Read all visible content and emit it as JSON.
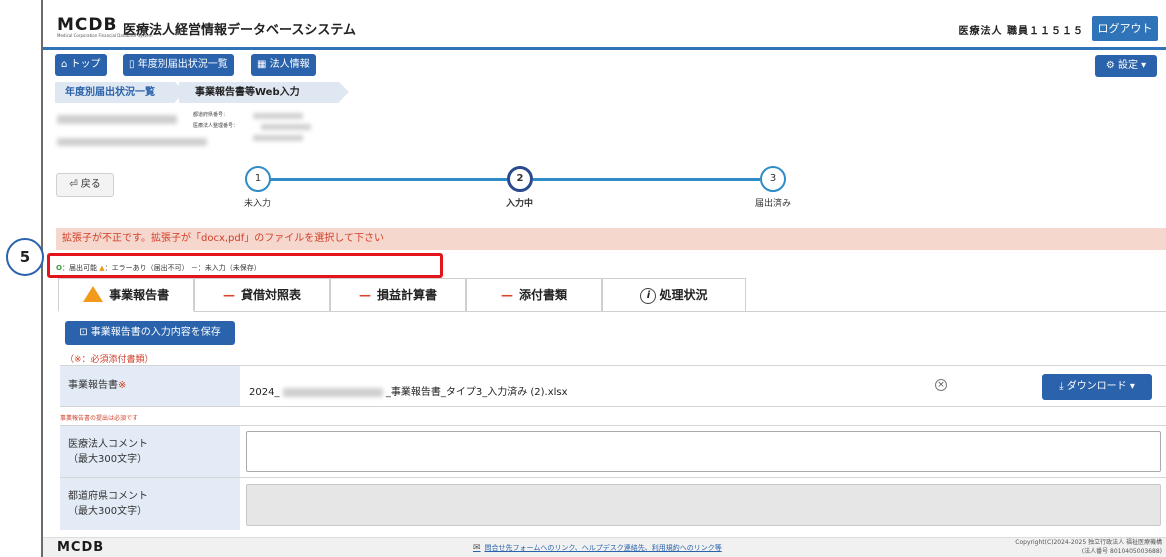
{
  "header": {
    "logo": "MCDB",
    "logo_sub": "Medical Corporation Financial Database System",
    "system_title": "医療法人経営情報データベースシステム",
    "user": "医療法人 職員１１５１５",
    "logout_label": "ログアウト"
  },
  "nav": {
    "top_label": "トップ",
    "yearly_label": "年度別届出状況一覧",
    "corp_label": "法人情報",
    "settings_label": "設定"
  },
  "breadcrumb": {
    "item1": "年度別届出状況一覧",
    "item2": "事業報告書等Web入力"
  },
  "corp_info": {
    "pref_label": "都道府県番号：",
    "corp_label": "医療法人整理番号："
  },
  "back_label": "戻る",
  "steps": [
    {
      "num": "1",
      "label": "未入力"
    },
    {
      "num": "2",
      "label": "入力中"
    },
    {
      "num": "3",
      "label": "届出済み"
    }
  ],
  "error_message": "拡張子が不正です。拡張子が「docx,pdf」のファイルを選択して下さい",
  "legend": {
    "ok_mark": "O",
    "ok_text": "：届出可能",
    "warn_mark": "▲",
    "warn_text": "：エラーあり（届出不可）",
    "dash_text": "－：未入力（未保存）"
  },
  "tabs": [
    {
      "label": "事業報告書"
    },
    {
      "label": "貸借対照表"
    },
    {
      "label": "損益計算書"
    },
    {
      "label": "添付書類"
    },
    {
      "label": "処理状況"
    }
  ],
  "save_label": "事業報告書の入力内容を保存",
  "required_note": "（※：必須添付書類）",
  "form": {
    "report_label": "事業報告書",
    "required_mark": "※",
    "file_prefix": "2024_",
    "file_suffix": "_事業報告書_タイプ3_入力済み (2).xlsx",
    "download_label": "ダウンロード",
    "report_error": "事業報告書の提出は必須です",
    "corp_comment_label": "医療法人コメント",
    "corp_comment_limit": "（最大300文字）",
    "pref_comment_label": "都道府県コメント",
    "pref_comment_limit": "（最大300文字）"
  },
  "footer": {
    "logo": "MCDB",
    "link_text": "問合せ先フォームへのリンク、ヘルプデスク連絡先、利用規約へのリンク等",
    "copyright": "Copyright(C)2024-2025 独立行政法人 福祉医療機構",
    "corp_number": "(法人番号 8010405003688)"
  },
  "annotation": {
    "number": "5"
  },
  "colors": {
    "primary": "#2a63ab",
    "error": "#d13f28",
    "warning": "#f29a1b",
    "ok": "#3a9a35",
    "annotation": "#e3141b"
  }
}
